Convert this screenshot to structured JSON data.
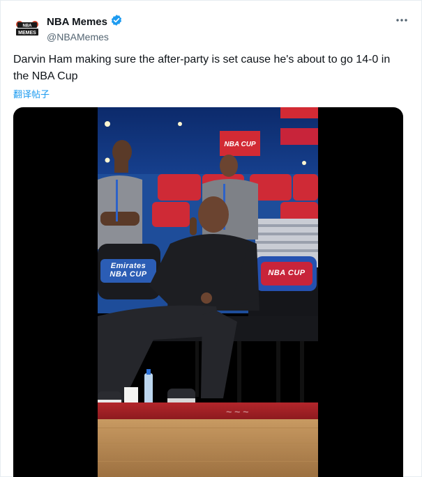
{
  "account": {
    "display_name": "NBA Memes",
    "handle": "@NBAMemes",
    "avatar_text": "NBA MEMES",
    "verified": true
  },
  "tweet": {
    "text": "Darvin Ham making sure the after-party is set cause he's about to go 14-0 in the NBA Cup",
    "translate_label": "翻译帖子"
  },
  "media": {
    "type": "video",
    "signage": [
      "NBA CUP",
      "Emirates NBA CUP",
      "NBA CUP"
    ]
  },
  "colors": {
    "accent": "#1d9bf0",
    "verified": "#1d9bf0",
    "text": "#0f1419",
    "secondary": "#536471"
  },
  "icons": {
    "verified": "verified-badge-icon",
    "more": "more-options-icon"
  }
}
